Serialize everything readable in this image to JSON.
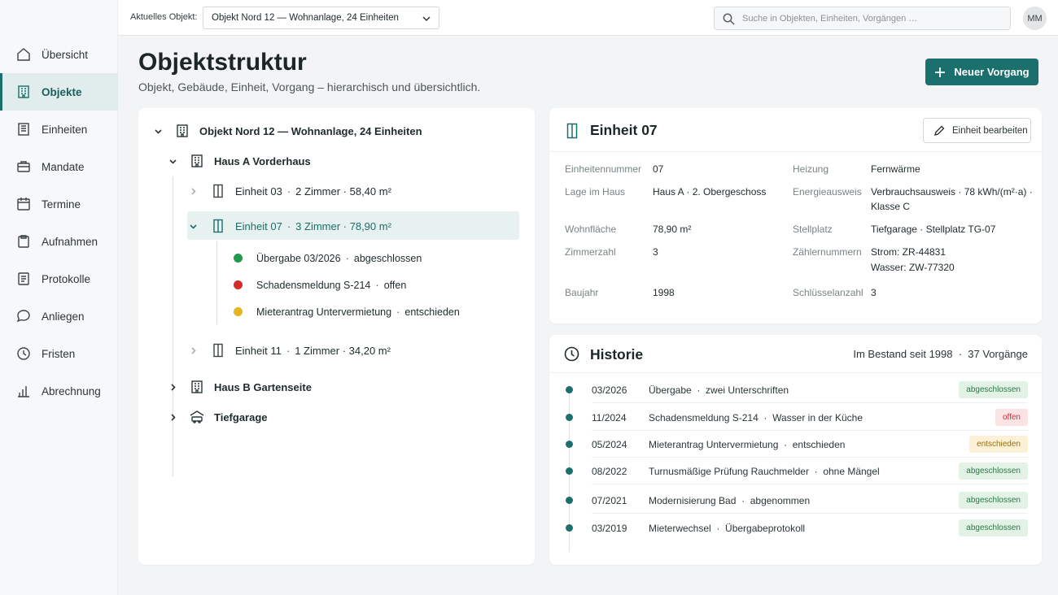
{
  "sidebar": {
    "items": [
      {
        "label": "Übersicht",
        "icon": "home-icon",
        "active": false
      },
      {
        "label": "Objekte",
        "icon": "building-icon",
        "active": true
      },
      {
        "label": "Einheiten",
        "icon": "units-icon",
        "active": false
      },
      {
        "label": "Mandate",
        "icon": "briefcase-icon",
        "active": false
      },
      {
        "label": "Termine",
        "icon": "calendar-icon",
        "active": false
      },
      {
        "label": "Aufnahmen",
        "icon": "clipboard-icon",
        "active": false
      },
      {
        "label": "Protokolle",
        "icon": "document-icon",
        "active": false
      },
      {
        "label": "Anliegen",
        "icon": "chat-icon",
        "active": false
      },
      {
        "label": "Fristen",
        "icon": "clock-icon",
        "active": false
      },
      {
        "label": "Abrechnung",
        "icon": "bar-chart-icon",
        "active": false
      }
    ]
  },
  "topbar": {
    "object_label": "Aktuelles Objekt:",
    "object_value": "Objekt Nord 12 — Wohnanlage, 24 Einheiten",
    "search_placeholder": "Suche in Objekten, Einheiten, Vorgängen …",
    "avatar_initials": "MM"
  },
  "header": {
    "title": "Objektstruktur",
    "subtitle": "Objekt, Gebäude, Einheit, Vorgang – hierarchisch und übersichtlich.",
    "new_button": "Neuer Vorgang"
  },
  "tree": {
    "root": "Objekt Nord 12 — Wohnanlage, 24 Einheiten",
    "haus_a": "Haus A Vorderhaus",
    "unit03": {
      "name": "Einheit 03",
      "details": "2 Zimmer · 58,40 m²"
    },
    "unit07": {
      "name": "Einheit 07",
      "details": "3 Zimmer · 78,90 m²"
    },
    "cases": [
      {
        "title": "Übergabe 03/2026",
        "status": "abgeschlossen",
        "color": "#1f9a4b"
      },
      {
        "title": "Schadensmeldung S-214",
        "status": "offen",
        "color": "#d62b2b"
      },
      {
        "title": "Mieterantrag Untervermietung",
        "status": "entschieden",
        "color": "#e3b521"
      }
    ],
    "unit11": {
      "name": "Einheit 11",
      "details": "1 Zimmer · 34,20 m²"
    },
    "haus_b": "Haus B Gartenseite",
    "garage": "Tiefgarage"
  },
  "detail": {
    "title": "Einheit 07",
    "edit_button": "Einheit bearbeiten",
    "left_fields": [
      {
        "label": "Einheitennummer",
        "value": "07"
      },
      {
        "label": "Lage im Haus",
        "value": "Haus A · 2. Obergeschoss"
      },
      {
        "label": "Wohnfläche",
        "value": "78,90 m²"
      },
      {
        "label": "Zimmerzahl",
        "value": "3"
      },
      {
        "label": "Baujahr",
        "value": "1998"
      }
    ],
    "right_fields": [
      {
        "label": "Heizung",
        "value": "Fernwärme",
        "value2": ""
      },
      {
        "label": "Energieausweis",
        "value": "Verbrauchsausweis · 78 kWh/(m²·a) ·",
        "value2": "Klasse C"
      },
      {
        "label": "Stellplatz",
        "value": "Tiefgarage · Stellplatz TG-07",
        "value2": ""
      },
      {
        "label": "Zählernummern",
        "value": "Strom: ZR-44831",
        "value2": "Wasser: ZW-77320"
      },
      {
        "label": "Schlüsselanzahl",
        "value": "3",
        "value2": ""
      }
    ]
  },
  "history": {
    "title": "Historie",
    "summary": "Im Bestand seit 1998  ·  37 Vorgänge",
    "rows": [
      {
        "date": "03/2026",
        "text": "Übergabe  ·  zwei Unterschriften",
        "badge": "abgeschlossen",
        "kind": "done"
      },
      {
        "date": "11/2024",
        "text": "Schadensmeldung S-214  ·  Wasser in der Küche",
        "badge": "offen",
        "kind": "open"
      },
      {
        "date": "05/2024",
        "text": "Mieterantrag Untervermietung  ·  entschieden",
        "badge": "entschieden",
        "kind": "decided"
      },
      {
        "date": "08/2022",
        "text": "Turnusmäßige Prüfung Rauchmelder  ·  ohne Mängel",
        "badge": "abgeschlossen",
        "kind": "done"
      },
      {
        "date": "07/2021",
        "text": "Modernisierung Bad  ·  abgenommen",
        "badge": "abgeschlossen",
        "kind": "done"
      },
      {
        "date": "03/2019",
        "text": "Mieterwechsel  ·  Übergabeprotokoll",
        "badge": "abgeschlossen",
        "kind": "done"
      }
    ],
    "badge_colors": {
      "done": {
        "bg": "#e3f2e6",
        "fg": "#2a7a43"
      },
      "open": {
        "bg": "#fbe3e3",
        "fg": "#c43636"
      },
      "decided": {
        "bg": "#fcf1d6",
        "fg": "#9a6f0f"
      }
    }
  },
  "colors": {
    "accent": "#1b6f6d",
    "background": "#f3f4f6"
  }
}
